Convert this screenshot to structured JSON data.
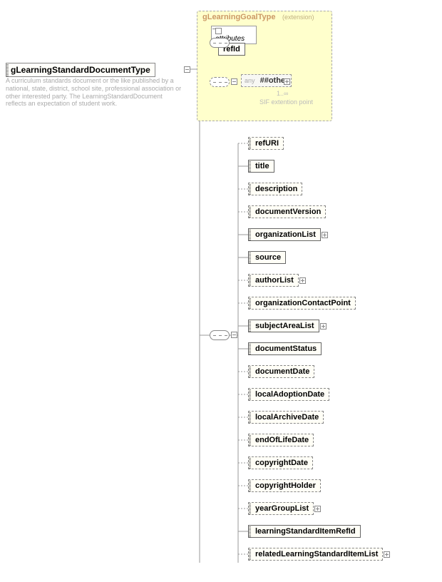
{
  "root": {
    "name": "gLearningStandardDocumentType",
    "description": "A curriculum standards document or the like published by a national, state, district, school site, professional association or other interested party. The LearningStandardDocument reflects an expectation of student work."
  },
  "extension": {
    "title": "gLearningGoalType",
    "subtitle": "(extension)",
    "attributes_label": "attributes",
    "refId": "refId",
    "any_label": "any",
    "any_value": "##other",
    "cardinality": "1..∞",
    "note": "SIF extention point"
  },
  "elements": [
    {
      "label": "refURI",
      "optional": true,
      "expand": false
    },
    {
      "label": "title",
      "optional": false,
      "expand": false
    },
    {
      "label": "description",
      "optional": true,
      "expand": false
    },
    {
      "label": "documentVersion",
      "optional": true,
      "expand": false
    },
    {
      "label": "organizationList",
      "optional": false,
      "expand": true
    },
    {
      "label": "source",
      "optional": false,
      "expand": false
    },
    {
      "label": "authorList",
      "optional": true,
      "expand": true
    },
    {
      "label": "organizationContactPoint",
      "optional": true,
      "expand": false
    },
    {
      "label": "subjectAreaList",
      "optional": false,
      "expand": true
    },
    {
      "label": "documentStatus",
      "optional": false,
      "expand": false
    },
    {
      "label": "documentDate",
      "optional": true,
      "expand": false
    },
    {
      "label": "localAdoptionDate",
      "optional": true,
      "expand": false
    },
    {
      "label": "localArchiveDate",
      "optional": true,
      "expand": false
    },
    {
      "label": "endOfLifeDate",
      "optional": true,
      "expand": false
    },
    {
      "label": "copyrightDate",
      "optional": true,
      "expand": false
    },
    {
      "label": "copyrightHolder",
      "optional": true,
      "expand": false
    },
    {
      "label": "yearGroupList",
      "optional": true,
      "expand": true
    },
    {
      "label": "learningStandardItemRefId",
      "optional": false,
      "expand": false
    },
    {
      "label": "relatedLearningStandardItemList",
      "optional": true,
      "expand": true
    }
  ]
}
